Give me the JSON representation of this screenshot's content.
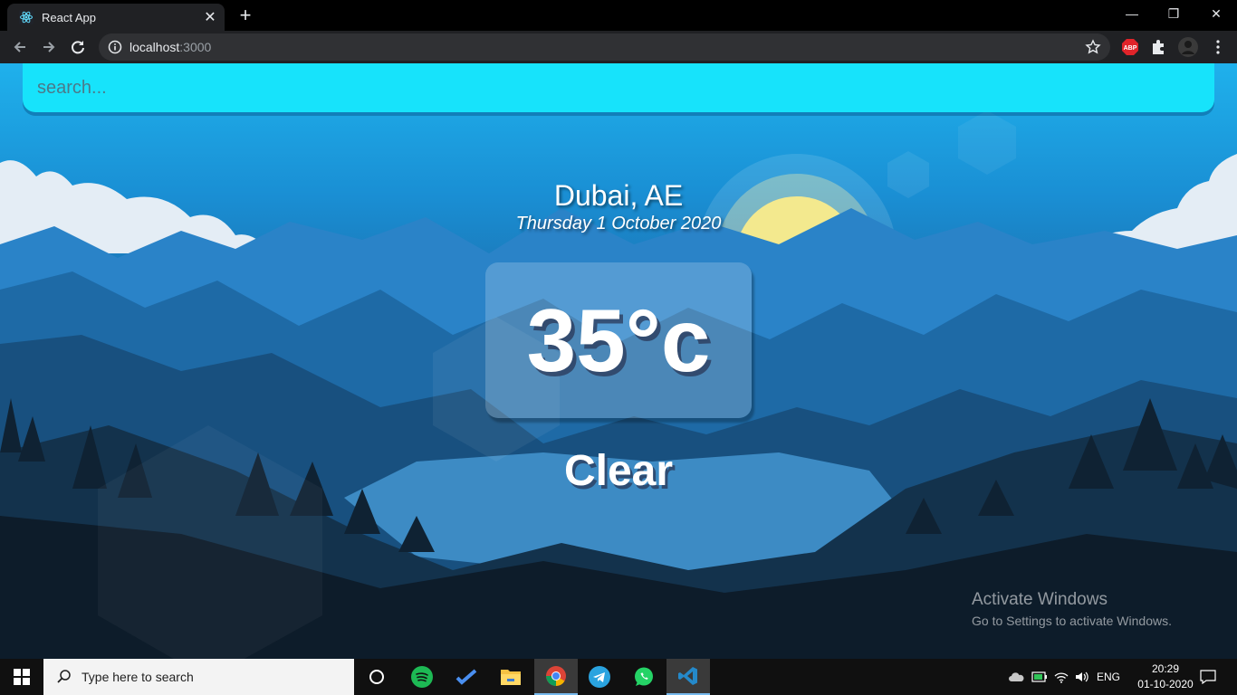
{
  "browser": {
    "tab_title": "React App",
    "url_host": "localhost",
    "url_port": ":3000",
    "tab_close_glyph": "✕",
    "new_tab_glyph": "+",
    "icons": [
      "react-icon",
      "back-icon",
      "forward-icon",
      "reload-icon",
      "info-icon",
      "star-icon",
      "adblock-icon",
      "puzzle-icon",
      "avatar",
      "menu-icon"
    ]
  },
  "window_controls": {
    "minimize": "—",
    "restore": "❐",
    "close": "✕"
  },
  "app": {
    "search_placeholder": "search...",
    "location": "Dubai, AE",
    "date": "Thursday 1 October 2020",
    "temperature": "35°c",
    "weather": "Clear",
    "search_bar_color": "#17e3fb"
  },
  "watermark": {
    "title": "Activate Windows",
    "subtitle": "Go to Settings to activate Windows."
  },
  "taskbar": {
    "search_placeholder": "Type here to search",
    "apps": [
      "cortana",
      "spotify",
      "todo",
      "file-explorer",
      "chrome",
      "telegram",
      "whatsapp",
      "vscode"
    ],
    "language": "ENG",
    "time": "20:29",
    "date": "01-10-2020"
  }
}
